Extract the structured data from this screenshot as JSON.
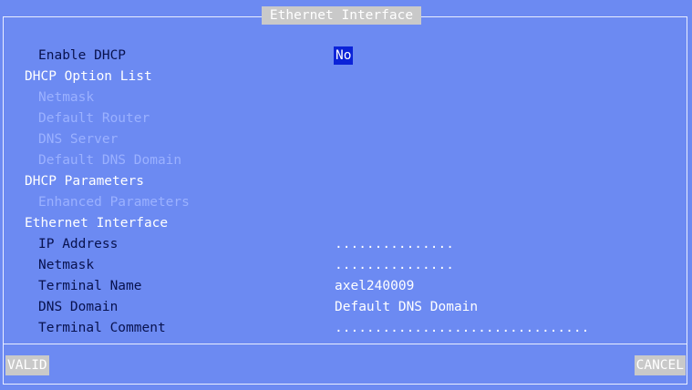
{
  "window": {
    "title": "Ethernet Interface"
  },
  "dhcp": {
    "enable_label": "Enable DHCP",
    "enable_value": "No",
    "option_list_label": "DHCP Option List",
    "options": [
      "Netmask",
      "Default Router",
      "DNS Server",
      "Default DNS Domain"
    ],
    "parameters_label": "DHCP Parameters",
    "enhanced_label": "Enhanced Parameters"
  },
  "ethernet": {
    "section_label": "Ethernet Interface",
    "fields": [
      {
        "label": "IP Address",
        "value": "..............."
      },
      {
        "label": "Netmask",
        "value": "..............."
      },
      {
        "label": "Terminal Name",
        "value": "axel240009"
      },
      {
        "label": "DNS Domain",
        "value": "Default DNS Domain"
      },
      {
        "label": "Terminal Comment",
        "value": "................................"
      }
    ]
  },
  "buttons": {
    "valid": "VALID",
    "cancel": "CANCEL"
  },
  "colors": {
    "background": "#6c8af2",
    "label_text": "#08124e",
    "section_text": "#ffffff",
    "disabled_text": "#9bb1ff",
    "selection": "#0b23d8",
    "button_face": "#c9c9c9"
  }
}
